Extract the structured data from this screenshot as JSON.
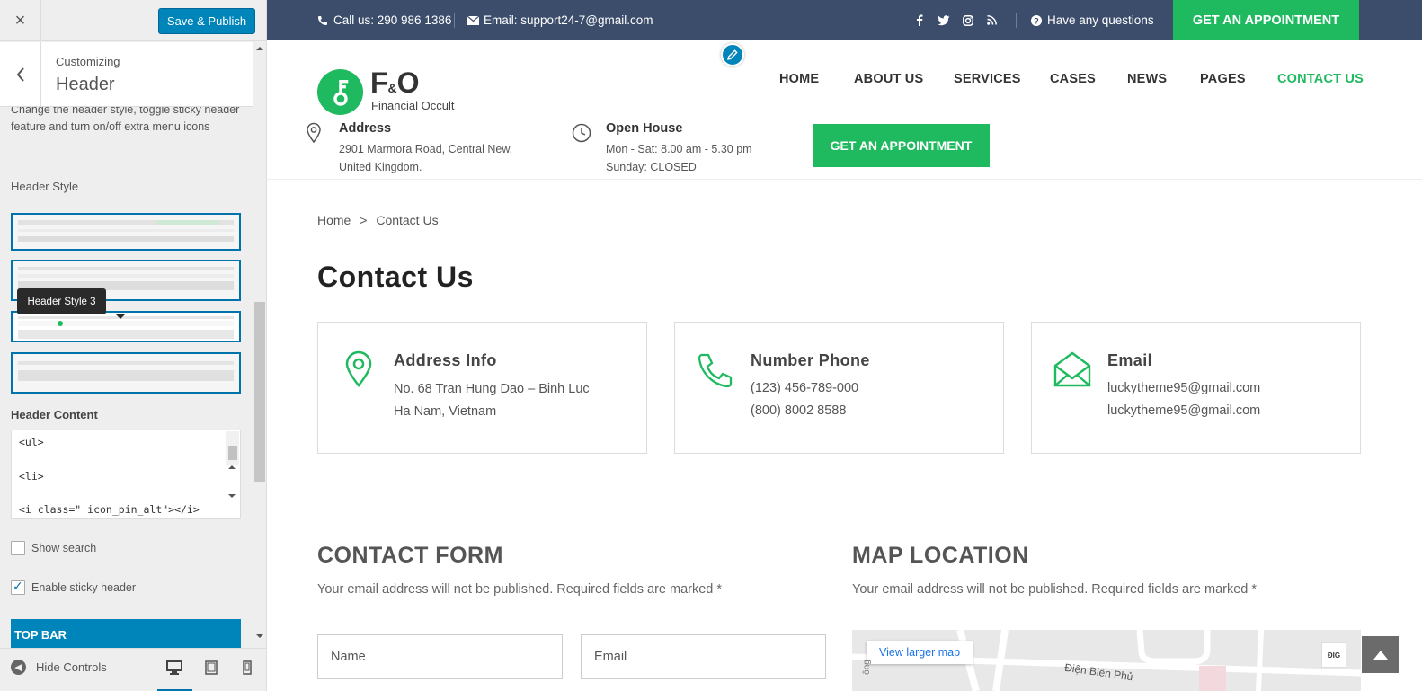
{
  "customizer": {
    "close_label": "×",
    "save_label": "Save & Publish",
    "customizing_label": "Customizing",
    "section_title": "Header",
    "description": "Change the header style, toggle sticky header feature and turn on/off extra menu icons",
    "header_style_label": "Header Style",
    "tooltip": "Header Style 3",
    "header_content_label": "Header Content",
    "header_content_lines": [
      "<ul>",
      "<li>",
      "<i class=\" icon_pin_alt\"></i>"
    ],
    "show_search_label": "Show search",
    "show_search_checked": false,
    "sticky_label": "Enable sticky header",
    "sticky_checked": true,
    "next_section": "TOP BAR",
    "hide_controls": "Hide Controls",
    "accent_color": "#0085ba"
  },
  "topbar": {
    "phone": "Call us: 290 986 1386",
    "email": "Email: support24-7@gmail.com",
    "question": "Have any questions",
    "appointment": "GET AN APPOINTMENT",
    "background_color": "#3b4d6b"
  },
  "header": {
    "logo_main_1": "F",
    "logo_main_amp": "&",
    "logo_main_2": "O",
    "logo_sub": "Financial Occult",
    "nav": [
      "HOME",
      "ABOUT US",
      "SERVICES",
      "CASES",
      "NEWS",
      "PAGES",
      "CONTACT US"
    ],
    "active_nav": "CONTACT US",
    "address_title": "Address",
    "address_lines": [
      "2901 Marmora Road, Central New,",
      "United Kingdom."
    ],
    "open_title": "Open House",
    "open_lines": [
      "Mon - Sat: 8.00 am - 5.30 pm",
      "Sunday: CLOSED"
    ],
    "appointment": "GET AN APPOINTMENT",
    "brand_color": "#1fba5f"
  },
  "breadcrumb": {
    "home": "Home",
    "separator": ">",
    "current": "Contact Us"
  },
  "page_title": "Contact Us",
  "cards": [
    {
      "title": "Address Info",
      "lines": [
        "No. 68 Tran Hung Dao – Binh Luc",
        "Ha Nam, Vietnam"
      ],
      "icon": "map-pin-icon"
    },
    {
      "title": "Number Phone",
      "lines": [
        "(123) 456-789-000",
        "(800) 8002 8588"
      ],
      "icon": "phone-icon"
    },
    {
      "title": "Email",
      "lines": [
        "luckytheme95@gmail.com",
        "luckytheme95@gmail.com"
      ],
      "icon": "envelope-icon"
    }
  ],
  "contact_form": {
    "title": "CONTACT FORM",
    "note": "Your email address will not be published. Required fields are marked *",
    "name_placeholder": "Name",
    "email_placeholder": "Email"
  },
  "map_location": {
    "title": "MAP LOCATION",
    "note": "Your email address will not be published. Required fields are marked *",
    "larger_map": "View larger map",
    "road_label": "Điện Biên Phủ",
    "side_label": "ông",
    "logo_text": "ĐIG"
  }
}
